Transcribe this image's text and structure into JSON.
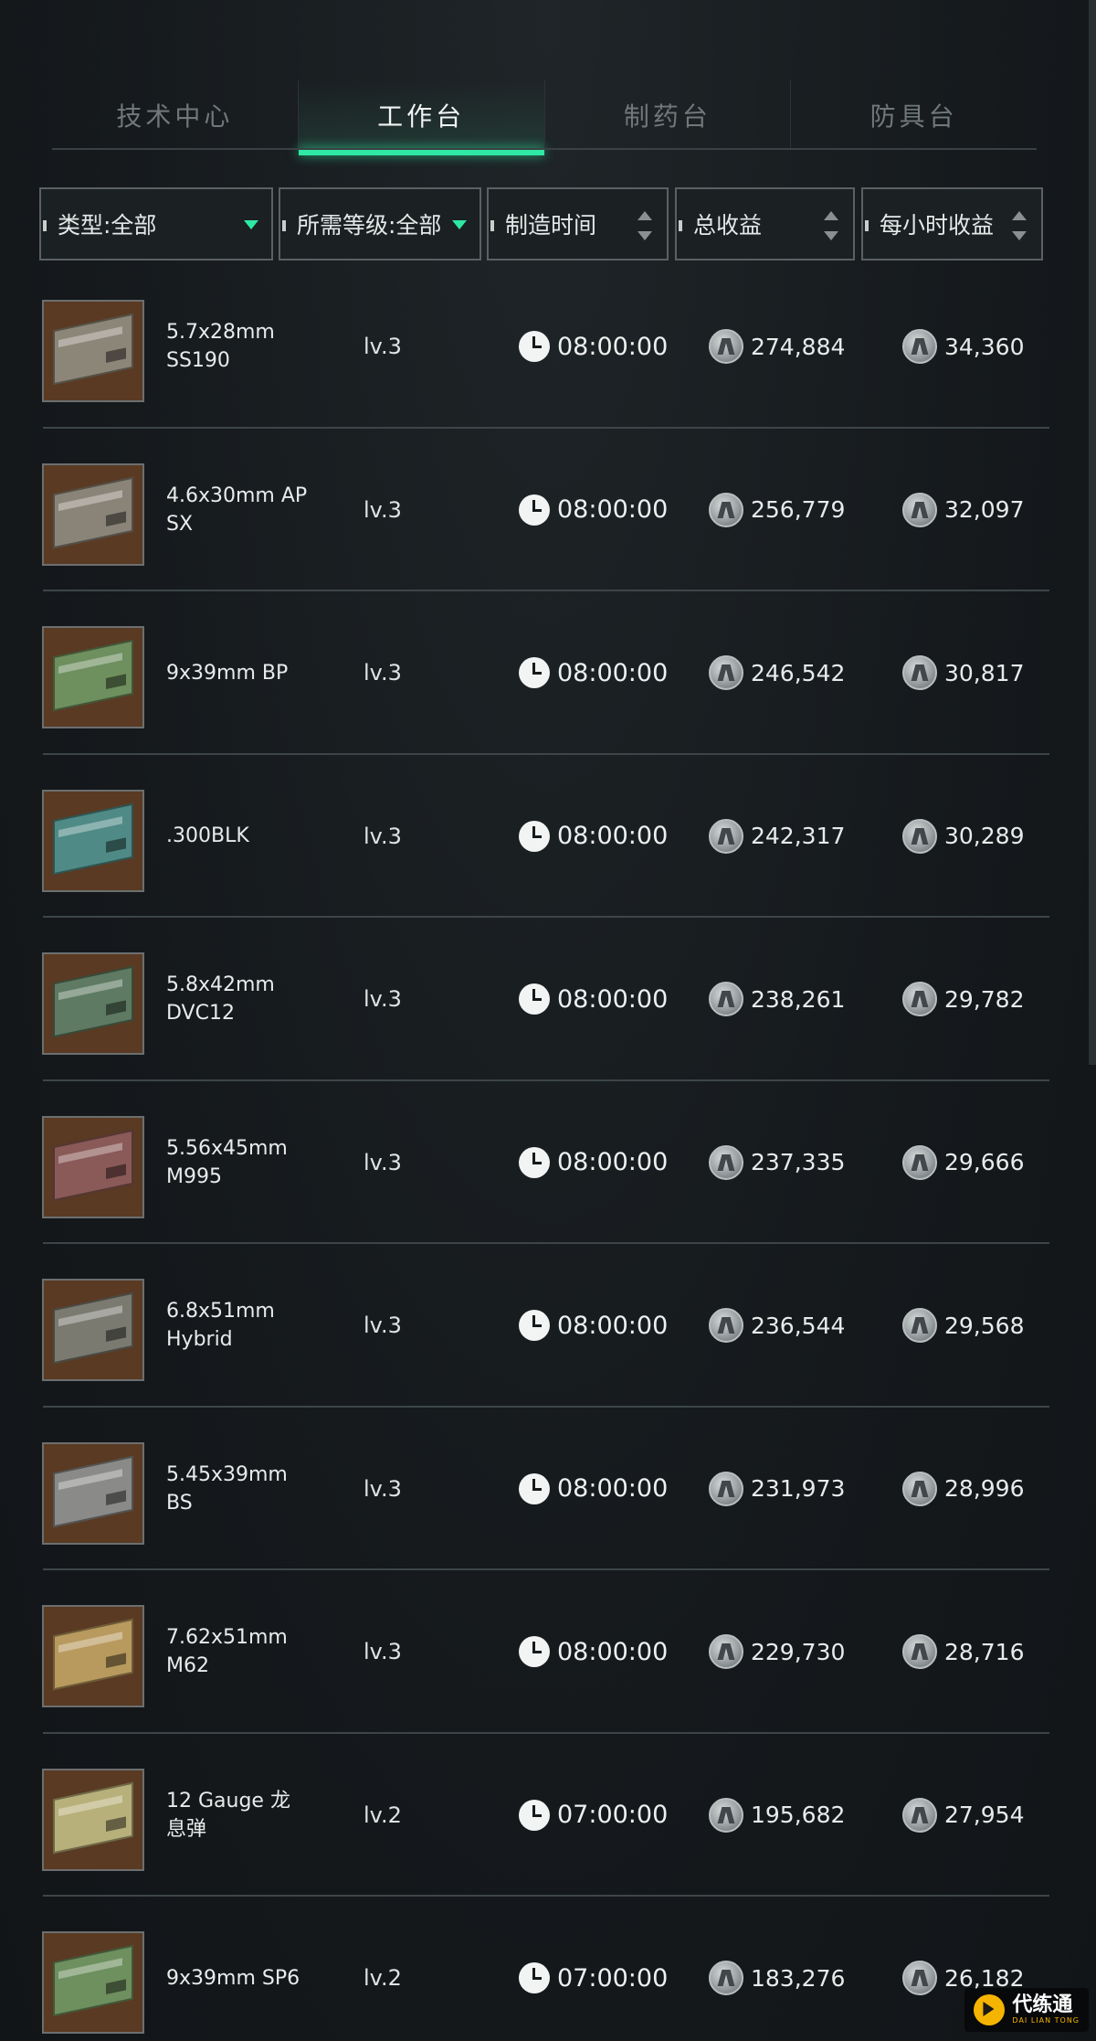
{
  "tabs": [
    {
      "label": "技术中心",
      "active": false
    },
    {
      "label": "工作台",
      "active": true
    },
    {
      "label": "制药台",
      "active": false
    },
    {
      "label": "防具台",
      "active": false
    }
  ],
  "filters": {
    "type": "类型:全部",
    "level": "所需等级:全部",
    "craft_time": "制造时间",
    "total_profit": "总收益",
    "hourly_profit": "每小时收益"
  },
  "colors": {
    "accent": "#2ee8a4",
    "background": "#161a1d",
    "divider": "#3d4548"
  },
  "items": [
    {
      "name": "5.7x28mm\nSS190",
      "level": "lv.3",
      "time": "08:00:00",
      "total": "274,884",
      "hourly": "34,360",
      "box_color": "#8c8678"
    },
    {
      "name": "4.6x30mm AP\nSX",
      "level": "lv.3",
      "time": "08:00:00",
      "total": "256,779",
      "hourly": "32,097",
      "box_color": "#8a8478"
    },
    {
      "name": "9x39mm BP",
      "level": "lv.3",
      "time": "08:00:00",
      "total": "246,542",
      "hourly": "30,817",
      "box_color": "#6e8f5e"
    },
    {
      "name": ".300BLK",
      "level": "lv.3",
      "time": "08:00:00",
      "total": "242,317",
      "hourly": "30,289",
      "box_color": "#4f8a86"
    },
    {
      "name": "5.8x42mm\nDVC12",
      "level": "lv.3",
      "time": "08:00:00",
      "total": "238,261",
      "hourly": "29,782",
      "box_color": "#5e7a62"
    },
    {
      "name": "5.56x45mm\nM995",
      "level": "lv.3",
      "time": "08:00:00",
      "total": "237,335",
      "hourly": "29,666",
      "box_color": "#8a5a58"
    },
    {
      "name": "6.8x51mm\nHybrid",
      "level": "lv.3",
      "time": "08:00:00",
      "total": "236,544",
      "hourly": "29,568",
      "box_color": "#7a7a70"
    },
    {
      "name": "5.45x39mm\nBS",
      "level": "lv.3",
      "time": "08:00:00",
      "total": "231,973",
      "hourly": "28,996",
      "box_color": "#8a8a88"
    },
    {
      "name": "7.62x51mm\nM62",
      "level": "lv.3",
      "time": "08:00:00",
      "total": "229,730",
      "hourly": "28,716",
      "box_color": "#b89a5e"
    },
    {
      "name": "12 Gauge 龙\n息弹",
      "level": "lv.2",
      "time": "07:00:00",
      "total": "195,682",
      "hourly": "27,954",
      "box_color": "#b8b07a"
    },
    {
      "name": "9x39mm SP6",
      "level": "lv.2",
      "time": "07:00:00",
      "total": "183,276",
      "hourly": "26,182",
      "box_color": "#6e8f5e"
    }
  ],
  "watermark": {
    "main": "代练通",
    "sub": "DAI LIAN TONG"
  }
}
